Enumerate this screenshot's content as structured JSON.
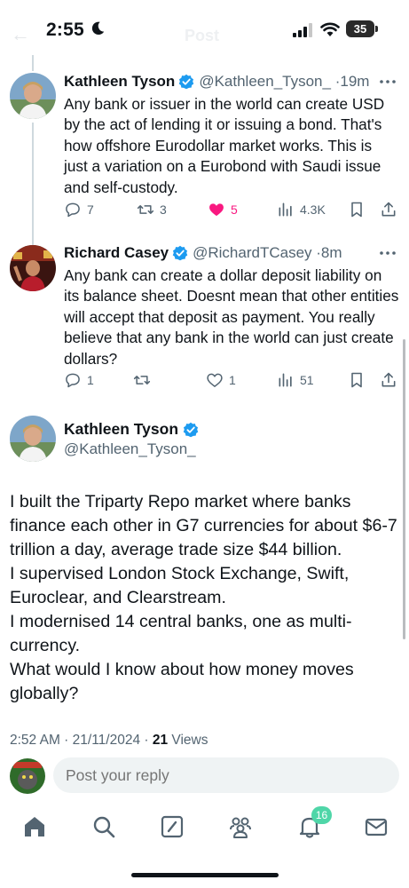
{
  "status_bar": {
    "time": "2:55",
    "battery": "35"
  },
  "header_ghost": {
    "title": "Post"
  },
  "replies": [
    {
      "author_name": "Kathleen Tyson",
      "author_handle": "@Kathleen_Tyson_",
      "time_ago": "19m",
      "text": "Any bank or issuer in the world can create USD by the act of lending it or issuing a bond. That's how offshore Eurodollar market works. This is just a variation on a Eurobond with Saudi issue and self-custody.",
      "replies": "7",
      "reposts": "3",
      "likes": "5",
      "views": "4.3K",
      "liked": true
    },
    {
      "author_name": "Richard Casey",
      "author_handle": "@RichardTCasey",
      "time_ago": "8m",
      "text": "Any bank can create a dollar deposit liability on its balance sheet. Doesnt mean that other entities will accept that deposit as payment. You really believe that any bank in the world can just create dollars?",
      "replies": "1",
      "reposts": "",
      "likes": "1",
      "views": "51",
      "liked": false
    }
  ],
  "main_post": {
    "author_name": "Kathleen Tyson",
    "author_handle": "@Kathleen_Tyson_",
    "text_lines": [
      "I built the Triparty Repo market where banks finance each other in G7 currencies for about $6-7 trillion a day, average trade size $44 billion.",
      "I supervised London Stock Exchange, Swift, Euroclear, and Clearstream.",
      "I modernised 14 central banks, one as multi-currency.",
      "What would I know about how money moves globally?"
    ],
    "timestamp": "2:52 AM · 21/11/2024 · ",
    "views_count": "21",
    "views_label": " Views"
  },
  "reply_box": {
    "placeholder": "Post your reply"
  },
  "tab_bar": {
    "items": [
      "home-icon",
      "search-icon",
      "compose-icon",
      "communities-icon",
      "notifications-icon",
      "messages-icon"
    ],
    "notification_count": "16"
  },
  "colors": {
    "accent": "#1d9bf0",
    "like": "#f91880",
    "muted": "#536471",
    "badge": "#4fd6a8"
  }
}
